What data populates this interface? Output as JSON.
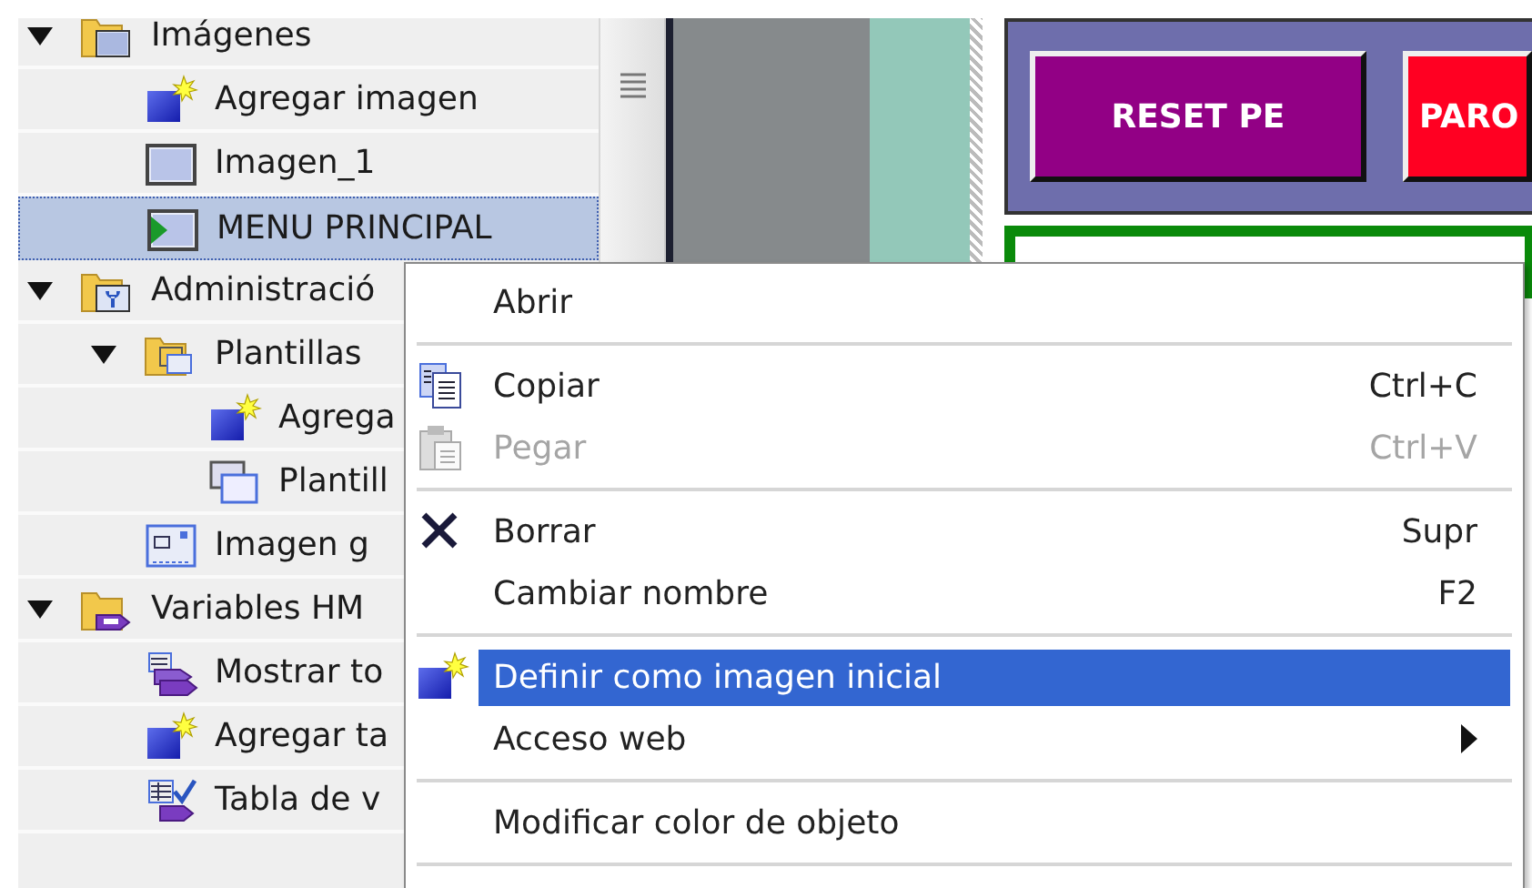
{
  "tree": [
    {
      "label": "Imágenes",
      "kind": "folder-screens",
      "expanded": true,
      "selected": false,
      "children": [
        {
          "label": "Agregar imagen",
          "kind": "add",
          "selected": false
        },
        {
          "label": "Imagen_1",
          "kind": "screen",
          "selected": false
        },
        {
          "label": "MENU PRINCIPAL",
          "kind": "start-screen",
          "selected": true
        }
      ]
    },
    {
      "label": "Administració",
      "kind": "folder-admin",
      "expanded": true,
      "selected": false,
      "children": [
        {
          "label": "Plantillas",
          "kind": "folder-templates",
          "expanded": true,
          "selected": false,
          "children": [
            {
              "label": "Agrega",
              "kind": "add",
              "selected": false
            },
            {
              "label": "Plantill",
              "kind": "template",
              "selected": false
            }
          ]
        },
        {
          "label": "Imagen g",
          "kind": "global-screen",
          "selected": false
        }
      ]
    },
    {
      "label": "Variables HM",
      "kind": "folder-tags",
      "expanded": true,
      "selected": false,
      "children": [
        {
          "label": "Mostrar to",
          "kind": "tags",
          "selected": false
        },
        {
          "label": "Agregar ta",
          "kind": "add",
          "selected": false
        },
        {
          "label": "Tabla de v",
          "kind": "tag-table",
          "selected": false
        }
      ]
    }
  ],
  "hmi_screen": {
    "buttons": [
      {
        "label": "RESET PE",
        "color": "#920085"
      },
      {
        "label": "PARO",
        "color": "#ff0022"
      }
    ]
  },
  "context_menu": {
    "groups": [
      [
        {
          "label": "Abrir",
          "selected": false,
          "disabled": false
        }
      ],
      [
        {
          "label": "Copiar",
          "shortcut": "Ctrl+C",
          "kind": "copy",
          "selected": false,
          "disabled": false
        },
        {
          "label": "Pegar",
          "shortcut": "Ctrl+V",
          "kind": "paste",
          "selected": false,
          "disabled": true
        }
      ],
      [
        {
          "label": "Borrar",
          "shortcut": "Supr",
          "kind": "delete",
          "selected": false,
          "disabled": false
        },
        {
          "label": "Cambiar nombre",
          "shortcut": "F2",
          "selected": false,
          "disabled": false
        }
      ],
      [
        {
          "label": "Definir como imagen inicial",
          "kind": "add",
          "selected": true,
          "disabled": false
        },
        {
          "label": "Acceso web",
          "submenu": true,
          "selected": false,
          "disabled": false
        }
      ],
      [
        {
          "label": "Modificar color de objeto",
          "selected": false,
          "disabled": false
        }
      ]
    ]
  }
}
